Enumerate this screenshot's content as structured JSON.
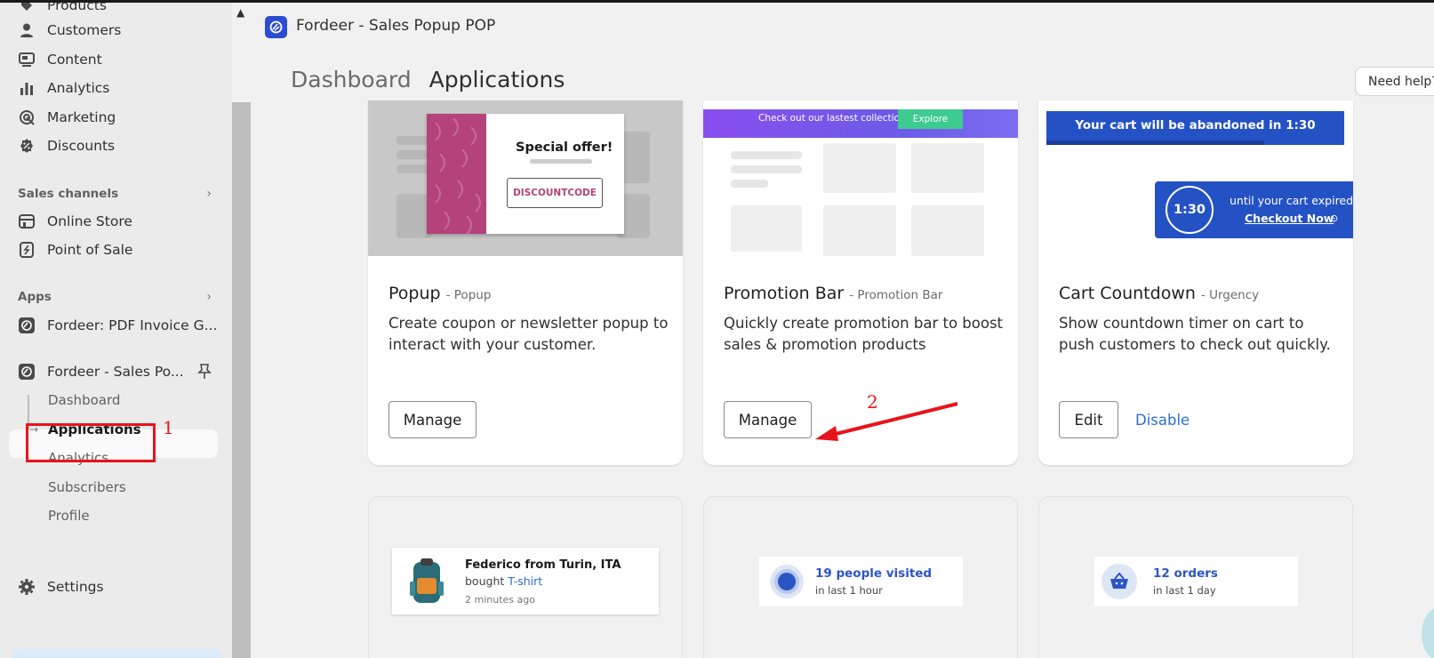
{
  "sidebar": {
    "top_cut": "Products",
    "items": [
      {
        "label": "Customers",
        "icon": "person-icon"
      },
      {
        "label": "Content",
        "icon": "content-icon"
      },
      {
        "label": "Analytics",
        "icon": "bar-chart-icon"
      },
      {
        "label": "Marketing",
        "icon": "target-icon"
      },
      {
        "label": "Discounts",
        "icon": "discount-icon"
      }
    ],
    "sales_channels_label": "Sales channels",
    "channels": [
      {
        "label": "Online Store",
        "icon": "store-icon"
      },
      {
        "label": "Point of Sale",
        "icon": "pos-icon"
      }
    ],
    "apps_label": "Apps",
    "apps": [
      {
        "label": "Fordeer: PDF Invoice G..."
      },
      {
        "label": "Fordeer - Sales Po..."
      }
    ],
    "sub_items": [
      "Dashboard",
      "Applications",
      "Analytics",
      "Subscribers",
      "Profile"
    ],
    "settings_label": "Settings"
  },
  "annotations": {
    "one": "1",
    "two": "2"
  },
  "header": {
    "app_name": "Fordeer - Sales Popup POP",
    "breadcrumb_parent": "Dashboard",
    "breadcrumb_current": "Applications",
    "help_button": "Need help?"
  },
  "cards": [
    {
      "title": "Popup",
      "category": "- Popup",
      "description": "Create coupon or newsletter popup to interact with your customer.",
      "primary": "Manage",
      "preview": {
        "offer": "Special offer!",
        "code": "DISCOUNTCODE"
      }
    },
    {
      "title": "Promotion Bar",
      "category": "- Promotion Bar",
      "description": "Quickly create promotion bar to boost sales & promotion products",
      "primary": "Manage",
      "preview": {
        "bar_text": "Check out our lastest collection",
        "bar_button": "Explore"
      }
    },
    {
      "title": "Cart Countdown",
      "category": "- Urgency",
      "description": "Show countdown timer on cart to push customers to check out quickly.",
      "primary": "Edit",
      "secondary": "Disable",
      "preview": {
        "banner": "Your cart will be abandoned in 1:30",
        "timer": "1:30",
        "note": "until your cart expired",
        "cta": "Checkout Now"
      }
    }
  ],
  "bottom_cards": [
    {
      "name": "Federico from Turin, ITA",
      "action": "bought",
      "product": "T-shirt",
      "time": "2 minutes ago"
    },
    {
      "headline": "19 people visited",
      "sub": "in last 1 hour"
    },
    {
      "headline": "12 orders",
      "sub": "in last 1 day"
    }
  ],
  "colors": {
    "accent": "#2c6ecb",
    "annotation": "#e8141c",
    "brand": "#2a4bd2"
  }
}
